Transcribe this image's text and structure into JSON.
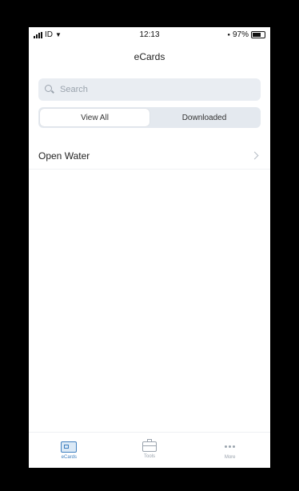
{
  "status_bar": {
    "carrier": "ID",
    "time": "12:13",
    "battery": "97%"
  },
  "header": {
    "title": "eCards"
  },
  "search": {
    "placeholder": "Search",
    "value": ""
  },
  "segment": {
    "options": [
      "View All",
      "Downloaded"
    ],
    "selected": "View All"
  },
  "list": {
    "items": [
      {
        "label": "Open Water"
      }
    ]
  },
  "tabbar": {
    "tabs": [
      {
        "label": "eCards",
        "icon": "card-icon",
        "active": true
      },
      {
        "label": "Tools",
        "icon": "bag-icon",
        "active": false
      },
      {
        "label": "More",
        "icon": "more-icon",
        "active": false
      }
    ]
  },
  "colors": {
    "accent": "#3f7fbf",
    "search_bg": "#e9edf2",
    "muted": "#9aa3ad"
  }
}
